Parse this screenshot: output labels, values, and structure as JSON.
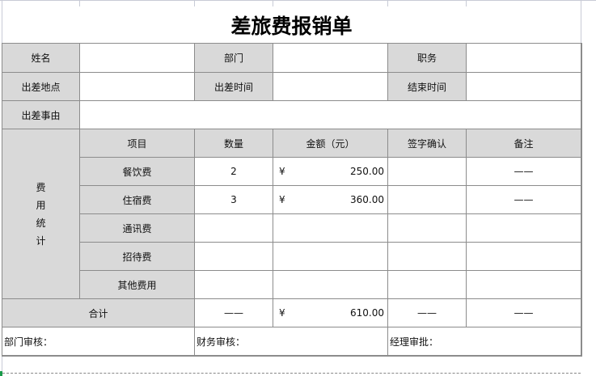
{
  "title": "差旅费报销单",
  "labels": {
    "name": "姓名",
    "department": "部门",
    "position": "职务",
    "trip_location": "出差地点",
    "trip_time": "出差时间",
    "end_time": "结束时间",
    "trip_reason": "出差事由",
    "expense_stats": [
      "费",
      "用",
      "统",
      "计"
    ]
  },
  "headers": {
    "item": "项目",
    "quantity": "数量",
    "amount": "金额（元）",
    "signature": "签字确认",
    "remark": "备注"
  },
  "rows": [
    {
      "item": "餐饮费",
      "quantity": "2",
      "currency": "¥",
      "amount": "250.00",
      "signature": "",
      "remark": "——"
    },
    {
      "item": "住宿费",
      "quantity": "3",
      "currency": "¥",
      "amount": "360.00",
      "signature": "",
      "remark": "——"
    },
    {
      "item": "通讯费",
      "quantity": "",
      "currency": "",
      "amount": "",
      "signature": "",
      "remark": ""
    },
    {
      "item": "招待费",
      "quantity": "",
      "currency": "",
      "amount": "",
      "signature": "",
      "remark": ""
    },
    {
      "item": "其他费用",
      "quantity": "",
      "currency": "",
      "amount": "",
      "signature": "",
      "remark": ""
    }
  ],
  "total": {
    "label": "合计",
    "quantity": "——",
    "currency": "¥",
    "amount": "610.00",
    "signature": "——",
    "remark": "——"
  },
  "approvals": {
    "dept": "部门审核：",
    "finance": "财务审核：",
    "manager": "经理审批："
  }
}
